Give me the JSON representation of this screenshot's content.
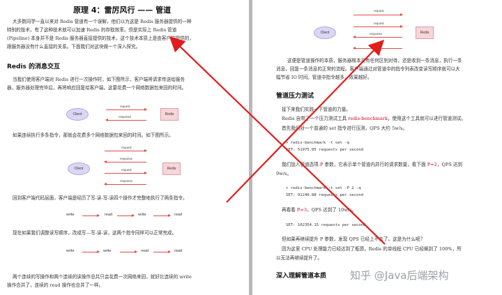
{
  "left": {
    "title": "原理 4：雷厉风行 —— 管道",
    "intro": [
      "大多数同学一直以来对 Redis 管道有一个误解，他们以为这是 Redis 服务器提供的一种",
      "特别的技术，有了这种技术就可以加速 Redis 的存取效率。但是实际上 Redis 管道",
      "(Pipeline) 本身并不是 Redis 服务器直接提供的技术，这个技术本质上是由客户端提供的，",
      "跟服务器没有什么直接的关系。下面我们对这块做一个深入探究。"
    ],
    "section1": "Redis 的消息交互",
    "para1": [
      "当我们使用客户端对 Redis 进行一次操作时，如下图所示，客户端将请求传送给服务",
      "器，服务器处理完毕后，再将响应回复给客户端。这要花费一个网络数据包来回的时间。"
    ],
    "diag1": {
      "client": "Client",
      "redis": "Redis",
      "arrows": [
        "request",
        "response"
      ]
    },
    "para2": "如果连续执行多条指令，那就会花费多个网络数据包来回的时间。如下图所示。",
    "diag2": {
      "client": "Client",
      "redis": "Redis",
      "arrows": [
        "request",
        "response",
        "request",
        "response"
      ]
    },
    "para3": "回到客户端代码层面，客户端是经历了写-读-写-读四个操作才完整地执行了两条指令。",
    "seq1": [
      "write",
      "read",
      "write",
      "read"
    ],
    "para4": "现在如果我们调整读写顺序，改成写—写-读-读，这两个指令同样可以正常完成。",
    "seq2": [
      "write",
      "write",
      "read",
      "read"
    ],
    "para5": [
      "两个连续的写操作和两个连续的读操作总共只会花费一次网络来回，就好比连续的 write",
      "操作合并了，连续的 read 操作也合并了一样。"
    ]
  },
  "right": {
    "diag3": {
      "client": "Client",
      "redis": "Redis",
      "arrows": [
        "request",
        "request",
        "response",
        "response"
      ]
    },
    "para1": [
      "这便是管道操作的本质，服务器根本没有任何区别对待，还是收到一条消息，执行一条",
      "消息，回复一条消息的正常的流程。客户端通过对管道中的指令列表改变读写顺序就可以大",
      "幅节省 IO 时间。管道中指令越多，效果越好。"
    ],
    "section1": "管道压力测试",
    "para2": "接下来我们实践一下管道的力量。",
    "para3a": "Redis 自带了一个压力测试工具 ",
    "para3tool": "redis-benchmark",
    "para3b": "，使用这个工具就可以进行管道测试。",
    "para4a": "首先我们对一个普通的 set 指令进行压测，QPS 大约 5w/s。",
    "code1": [
      "> redis-benchmark -t set -q",
      "SET: 51975.05 requests per second"
    ],
    "para5a": "我们加入管道选项",
    "para5p": "-P",
    "para5b": " 参数，它表示单个管道内并行的请求数量，看下面 ",
    "para5v": "P=2",
    "para5c": "，QPS 达到",
    "para5d": "9w/s。",
    "code2": [
      "> redis-benchmark -t set -P 2 -q",
      "SET: 91240.88 requests per second"
    ],
    "para6a": "再看看 ",
    "para6v": "P=3",
    "para6b": "，QPS 达到了 10w/s。",
    "code3": "SET: 102354.15 requests per second",
    "para7": "但如果再继续提升 P 参数，发现 QPS 已经上不去了。这是为什么呢？",
    "para8": [
      "因为这里 CPU 处理能力已经达到了瓶颈，Redis 的单线程 CPU 已经飙到了 100%，所",
      "以无法再继续提升了。"
    ],
    "section2": "深入理解管道本质",
    "watermark": "知乎 @Java后端架构"
  },
  "colors": {
    "accent_red": "#d0021b",
    "arrow": "#e04a4a",
    "client_fill": "#dcd6f5",
    "redis_fill": "#f7d5d9"
  }
}
